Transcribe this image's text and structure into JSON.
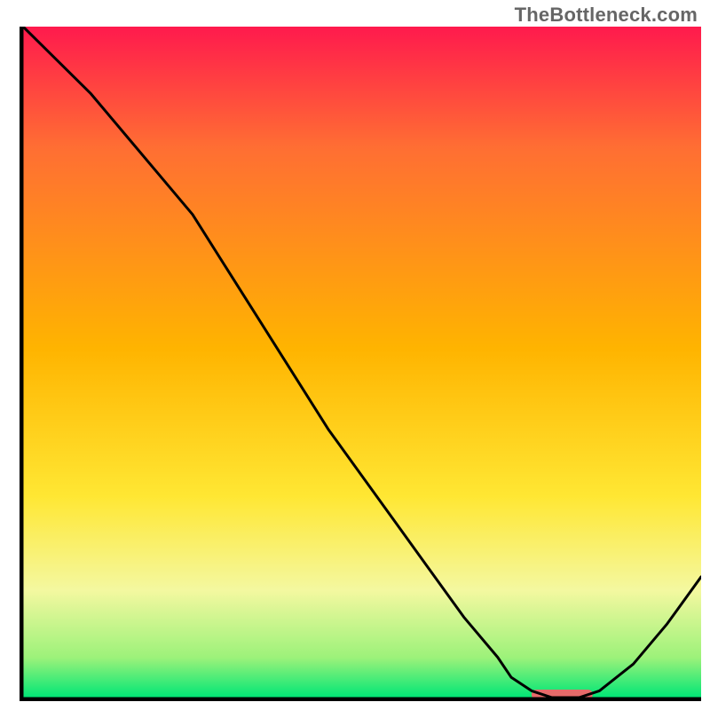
{
  "watermark": "TheBottleneck.com",
  "colors": {
    "top": "#ff1a4d",
    "mid1": "#ff6e33",
    "mid2": "#ffb400",
    "mid3": "#ffe733",
    "low1": "#f4f8a0",
    "low2": "#9df27a",
    "bottom": "#00e676",
    "curve": "#000000",
    "marker": "#e66a6a",
    "axis": "#000000"
  },
  "chart_data": {
    "type": "line",
    "title": "",
    "xlabel": "",
    "ylabel": "",
    "xlim": [
      0,
      100
    ],
    "ylim": [
      0,
      100
    ],
    "x": [
      0,
      5,
      10,
      15,
      20,
      25,
      30,
      35,
      40,
      45,
      50,
      55,
      60,
      65,
      70,
      72,
      75,
      78,
      82,
      85,
      90,
      95,
      100
    ],
    "values": [
      100,
      95,
      90,
      84,
      78,
      72,
      64,
      56,
      48,
      40,
      33,
      26,
      19,
      12,
      6,
      3,
      1,
      0,
      0,
      1,
      5,
      11,
      18
    ],
    "marker": {
      "x_start": 75,
      "x_end": 84,
      "y": 0
    },
    "gradient_stops": [
      {
        "pct": 0,
        "key": "top"
      },
      {
        "pct": 18,
        "key": "mid1"
      },
      {
        "pct": 48,
        "key": "mid2"
      },
      {
        "pct": 70,
        "key": "mid3"
      },
      {
        "pct": 84,
        "key": "low1"
      },
      {
        "pct": 94,
        "key": "low2"
      },
      {
        "pct": 100,
        "key": "bottom"
      }
    ]
  }
}
